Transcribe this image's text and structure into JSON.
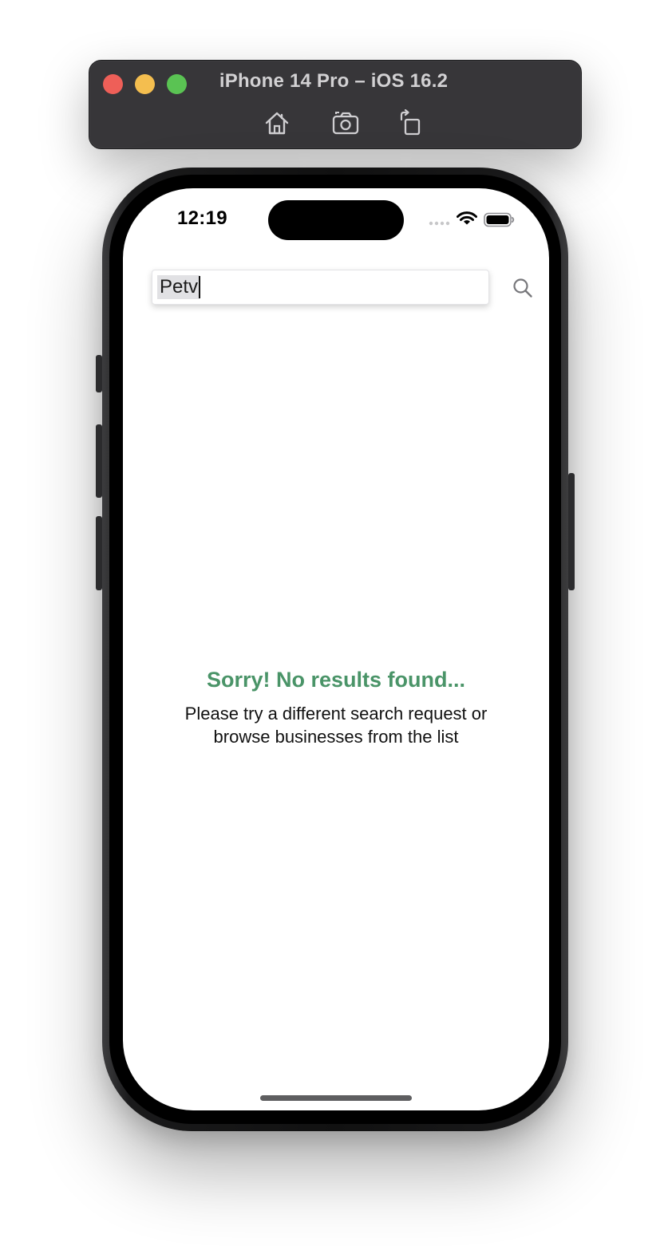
{
  "simulator": {
    "title": "iPhone 14 Pro – iOS 16.2",
    "toolbar_buttons": [
      {
        "icon": "home-icon"
      },
      {
        "icon": "camera-icon"
      },
      {
        "icon": "rotate-icon"
      }
    ]
  },
  "status_bar": {
    "time": "12:19",
    "icons": [
      "signal-icon",
      "wifi-icon",
      "battery-icon"
    ]
  },
  "search": {
    "value": "Petv",
    "icon": "search-icon"
  },
  "empty_state": {
    "title": "Sorry! No results found...",
    "message": "Please try a different search request or browse businesses from the list"
  },
  "colors": {
    "accent": "#4a9468",
    "toolbar_bg": "#373639"
  }
}
